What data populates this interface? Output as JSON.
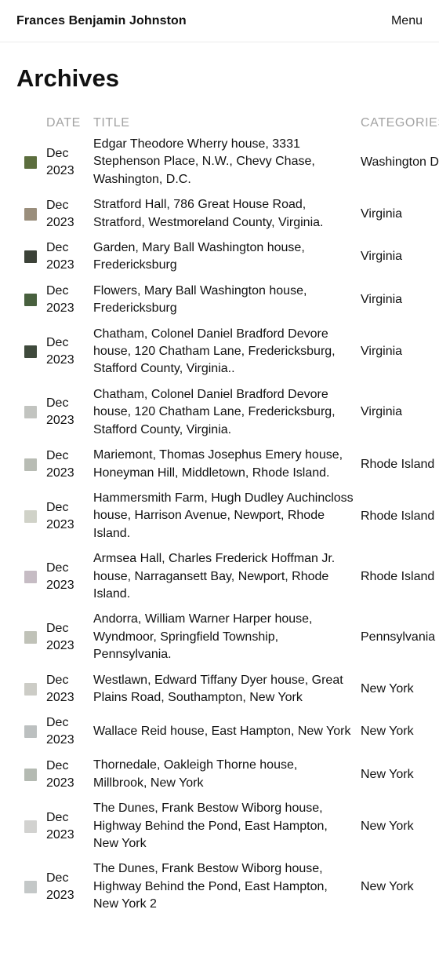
{
  "header": {
    "site_title": "Frances Benjamin Johnston",
    "menu_label": "Menu"
  },
  "page": {
    "title": "Archives"
  },
  "table": {
    "columns": {
      "date": "DATE",
      "title": "TITLE",
      "categories": "CATEGORIES"
    },
    "rows": [
      {
        "thumb_color": "#5c6e3e",
        "date": "Dec 2023",
        "title": "Edgar Theodore Wherry house, 3331 Stephenson Place, N.W., Chevy Chase, Washington, D.C.",
        "category": "Washington D.C."
      },
      {
        "thumb_color": "#9a8e7c",
        "date": "Dec 2023",
        "title": "Stratford Hall, 786 Great House Road, Stratford, Westmoreland County, Virginia.",
        "category": "Virginia"
      },
      {
        "thumb_color": "#3c4238",
        "date": "Dec 2023",
        "title": "Garden, Mary Ball Washington house, Fredericksburg",
        "category": "Virginia"
      },
      {
        "thumb_color": "#48603e",
        "date": "Dec 2023",
        "title": "Flowers, Mary Ball Washington house, Fredericksburg",
        "category": "Virginia"
      },
      {
        "thumb_color": "#3f4a3c",
        "date": "Dec 2023",
        "title": "Chatham, Colonel Daniel Bradford Devore house, 120 Chatham Lane, Fredericksburg, Stafford County, Virginia..",
        "category": "Virginia"
      },
      {
        "thumb_color": "#c2c4c0",
        "date": "Dec 2023",
        "title": "Chatham, Colonel Daniel Bradford Devore house, 120 Chatham Lane, Fredericksburg, Stafford County, Virginia.",
        "category": "Virginia"
      },
      {
        "thumb_color": "#b8bcb4",
        "date": "Dec 2023",
        "title": "Mariemont, Thomas Josephus Emery house, Honeyman Hill, Middletown, Rhode Island.",
        "category": "Rhode Island"
      },
      {
        "thumb_color": "#d0d2c8",
        "date": "Dec 2023",
        "title": "Hammersmith Farm, Hugh Dudley Auchincloss house, Harrison Avenue, Newport, Rhode Island.",
        "category": "Rhode Island"
      },
      {
        "thumb_color": "#c6bcc4",
        "date": "Dec 2023",
        "title": "Armsea Hall, Charles Frederick Hoffman Jr. house, Narragansett Bay, Newport, Rhode Island.",
        "category": "Rhode Island"
      },
      {
        "thumb_color": "#c0c2b8",
        "date": "Dec 2023",
        "title": "Andorra, William Warner Harper house, Wyndmoor, Springfield Township, Pennsylvania.",
        "category": "Pennsylvania"
      },
      {
        "thumb_color": "#ccccc6",
        "date": "Dec 2023",
        "title": "Westlawn, Edward Tiffany Dyer house, Great Plains Road, Southampton, New York",
        "category": "New York"
      },
      {
        "thumb_color": "#bcc0c0",
        "date": "Dec 2023",
        "title": "Wallace Reid house, East Hampton, New York",
        "category": "New York"
      },
      {
        "thumb_color": "#b4bab2",
        "date": "Dec 2023",
        "title": "Thornedale, Oakleigh Thorne house, Millbrook, New York",
        "category": "New York"
      },
      {
        "thumb_color": "#d2d2d0",
        "date": "Dec 2023",
        "title": "The Dunes, Frank Bestow Wiborg house, Highway Behind the Pond, East Hampton, New York",
        "category": "New York"
      },
      {
        "thumb_color": "#c4c8c8",
        "date": "Dec 2023",
        "title": "The Dunes, Frank Bestow Wiborg house, Highway Behind the Pond, East Hampton, New York 2",
        "category": "New York"
      }
    ]
  }
}
